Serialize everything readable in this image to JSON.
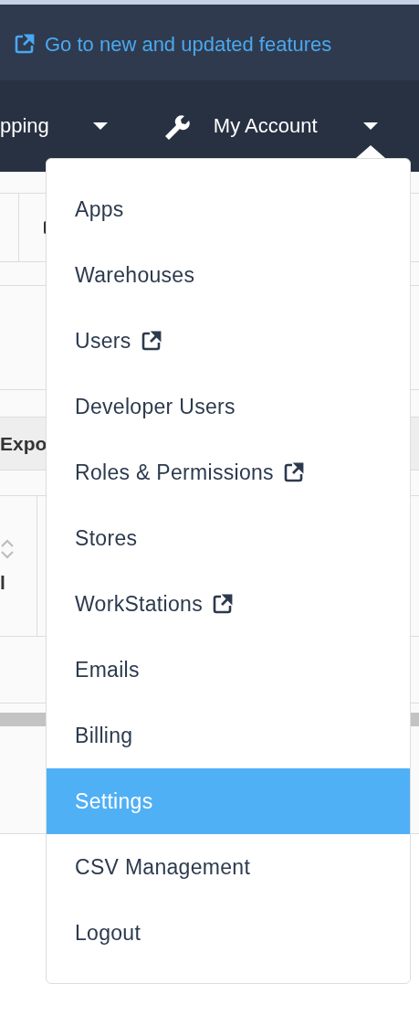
{
  "banner": {
    "link": "Go to new and updated features"
  },
  "nav": [
    {
      "label": "pping",
      "kind": "dropdown"
    },
    {
      "label": "My Account",
      "kind": "account",
      "expanded": true
    }
  ],
  "page_behind": {
    "export_button": "Expo",
    "header_left": "l"
  },
  "menu": [
    {
      "label": "Apps",
      "external": false,
      "selected": false
    },
    {
      "label": "Warehouses",
      "external": false,
      "selected": false
    },
    {
      "label": "Users",
      "external": true,
      "selected": false
    },
    {
      "label": "Developer Users",
      "external": false,
      "selected": false
    },
    {
      "label": "Roles & Permissions",
      "external": true,
      "selected": false
    },
    {
      "label": "Stores",
      "external": false,
      "selected": false
    },
    {
      "label": "WorkStations",
      "external": true,
      "selected": false
    },
    {
      "label": "Emails",
      "external": false,
      "selected": false
    },
    {
      "label": "Billing",
      "external": false,
      "selected": false
    },
    {
      "label": "Settings",
      "external": false,
      "selected": true
    },
    {
      "label": "CSV Management",
      "external": false,
      "selected": false
    },
    {
      "label": "Logout",
      "external": false,
      "selected": false
    }
  ]
}
